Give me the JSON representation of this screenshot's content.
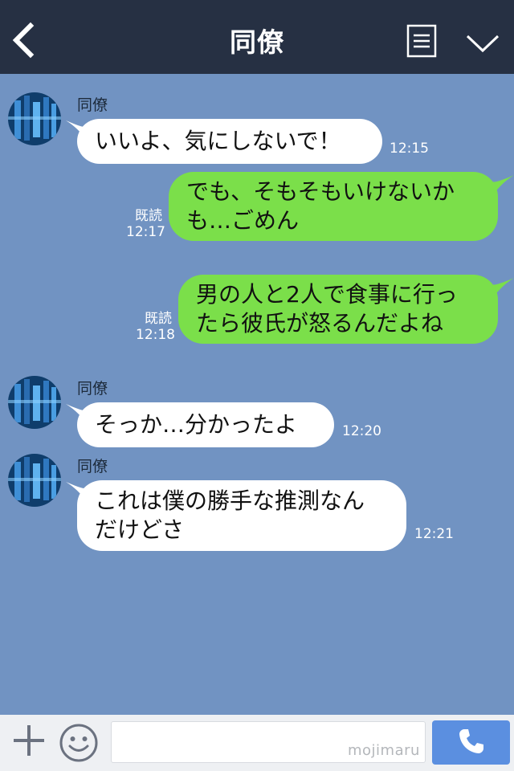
{
  "header": {
    "title": "同僚",
    "back_icon": "chevron-left-icon",
    "menu_icon": "menu-icon",
    "dropdown_icon": "chevron-down-icon"
  },
  "colors": {
    "header_bg": "#263043",
    "chat_bg": "#7193c2",
    "bubble_incoming": "#ffffff",
    "bubble_outgoing": "#7bdf4a",
    "send_button": "#5b8fe0"
  },
  "messages": [
    {
      "direction": "incoming",
      "sender": "同僚",
      "text": "いいよ、気にしないで！",
      "time": "12:15"
    },
    {
      "direction": "outgoing",
      "read": "既読",
      "text": "でも、そもそもいけないか\nも…ごめん",
      "time": "12:17"
    },
    {
      "direction": "outgoing",
      "read": "既読",
      "text": "男の人と2人で食事に行っ\nたら彼氏が怒るんだよね",
      "time": "12:18"
    },
    {
      "direction": "incoming",
      "sender": "同僚",
      "text": "そっか…分かったよ",
      "time": "12:20"
    },
    {
      "direction": "incoming",
      "sender": "同僚",
      "text": "これは僕の勝手な推測なん\nだけどさ",
      "time": "12:21"
    }
  ],
  "footer": {
    "plus_icon": "plus-icon",
    "emoji_icon": "smiley-icon",
    "input_value": "",
    "watermark": "mojimaru",
    "call_icon": "phone-icon"
  }
}
